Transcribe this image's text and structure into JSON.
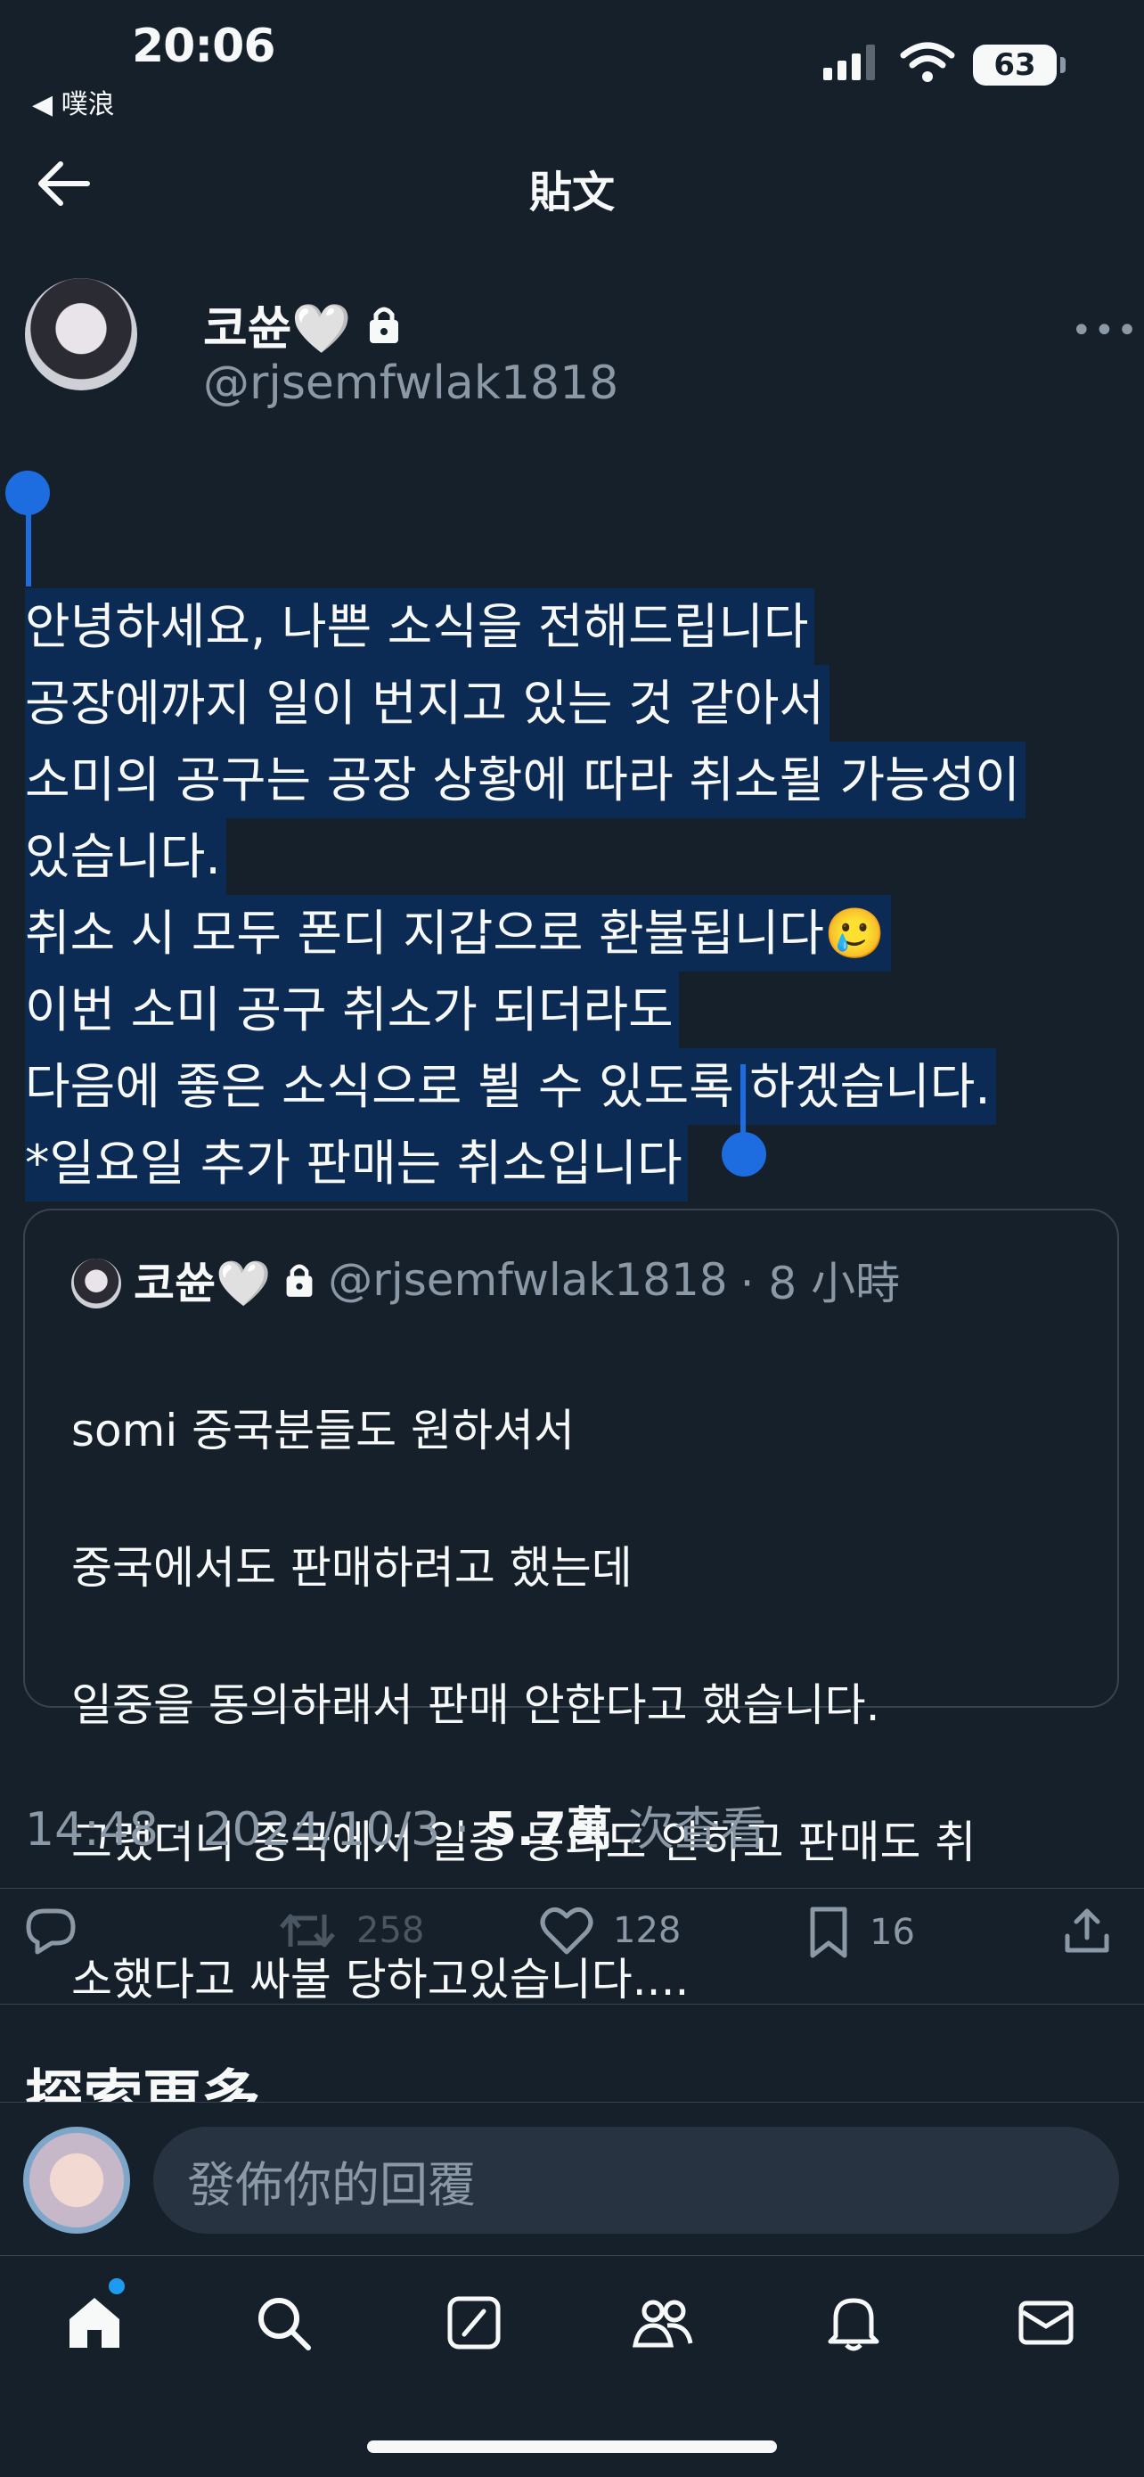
{
  "status_bar": {
    "time": "20:06",
    "back_app": "◀ 噗浪",
    "battery": "63"
  },
  "header": {
    "title": "貼文"
  },
  "author": {
    "name": "코쓘🤍",
    "handle": "@rjsemfwlak1818"
  },
  "post": {
    "lines": [
      "안녕하세요, 나쁜 소식을 전해드립니다",
      "공장에까지 일이 번지고 있는 것 같아서",
      "소미의 공구는 공장 상황에 따라 취소될 가능성이",
      "있습니다.",
      "취소 시 모두 폰디 지갑으로 환불됩니다🥲",
      "이번 소미 공구 취소가 되더라도",
      "다음에 좋은 소식으로 뵐 수 있도록 하겠습니다.",
      "*일요일 추가 판매는 취소입니다"
    ]
  },
  "quote": {
    "name": "코쓘🤍",
    "handle": "@rjsemfwlak1818",
    "time": "· 8 小時",
    "lines": [
      "somi 중국분들도 원하셔서",
      "중국에서도 판매하려고 했는데",
      "일중을 동의하래서 판매 안한다고 했습니다.",
      "그랬더니 중국에서 일중 동의도 안하고 판매도 취",
      "소했다고 싸불 당하고있습니다...."
    ]
  },
  "meta": {
    "time": "14:48",
    "date": "2024/10/3",
    "views": "5.7萬",
    "views_label": "次查看"
  },
  "actions": {
    "retweets": "258",
    "likes": "128",
    "bookmarks": "16"
  },
  "explore_title": "探索更多",
  "reply": {
    "placeholder": "發佈你的回覆"
  },
  "colors": {
    "background": "#15202b",
    "selection": "#0c2b54",
    "accent": "#1d9bf0"
  }
}
